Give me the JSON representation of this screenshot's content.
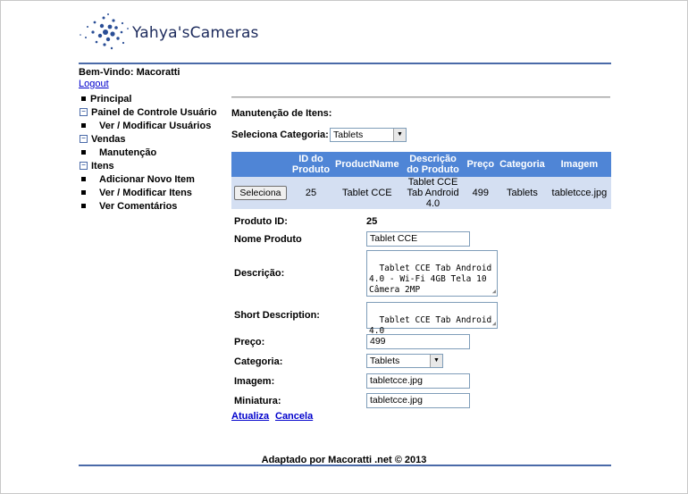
{
  "header": {
    "logo_text": "Yahya'sCameras"
  },
  "user": {
    "welcome": "Bem-Vindo: Macoratti",
    "logout": "Logout"
  },
  "nav": {
    "principal": "Principal",
    "painel": "Painel de Controle Usuário",
    "ver_modificar_usuarios": "Ver / Modificar Usuários",
    "vendas": "Vendas",
    "manutencao": "Manutenção",
    "itens": "Itens",
    "adicionar_novo_item": "Adicionar Novo Item",
    "ver_modificar_itens": "Ver / Modificar Itens",
    "ver_comentarios": "Ver Comentários"
  },
  "main": {
    "title": "Manutenção de Itens:",
    "category_label": "Seleciona Categoria:",
    "category_selected": "Tablets"
  },
  "grid": {
    "headers": [
      "",
      "ID do Produto",
      "ProductName",
      "Descrição do Produto",
      "Preço",
      "Categoria",
      "Imagem"
    ],
    "row": {
      "select_label": "Seleciona",
      "id": "25",
      "name": "Tablet CCE",
      "description": "Tablet CCE Tab Android 4.0",
      "price": "499",
      "category": "Tablets",
      "image": "tabletcce.jpg"
    }
  },
  "form": {
    "produto_id_label": "Produto ID:",
    "produto_id_value": "25",
    "nome_label": "Nome Produto",
    "nome_value": "Tablet CCE",
    "descricao_label": "Descrição:",
    "descricao_value": "Tablet CCE Tab Android 4.0 - Wi-Fi 4GB Tela 10 Câmera 2MP",
    "short_label": "Short Description:",
    "short_value": "Tablet CCE Tab Android 4.0",
    "preco_label": "Preço:",
    "preco_value": "499",
    "categoria_label": "Categoria:",
    "categoria_value": "Tablets",
    "imagem_label": "Imagem:",
    "imagem_value": "tabletcce.jpg",
    "miniatura_label": "Miniatura:",
    "miniatura_value": "tabletcce.jpg",
    "atualiza": "Atualiza",
    "cancela": "Cancela"
  },
  "footer": {
    "text": "Adaptado por Macoratti .net © 2013"
  },
  "colors": {
    "header_bg": "#4f85d6",
    "row_bg": "#d4dff2",
    "rule": "#4a6aa8",
    "link": "#0000cc"
  }
}
